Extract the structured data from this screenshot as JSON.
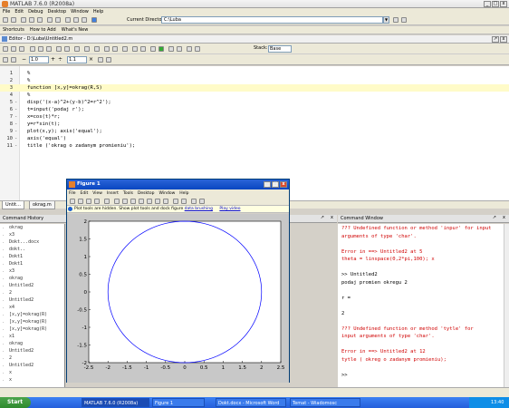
{
  "window": {
    "title": "MATLAB 7.6.0 (R2008a)"
  },
  "menu": [
    "File",
    "Edit",
    "Debug",
    "Desktop",
    "Window",
    "Help"
  ],
  "toolbar": {
    "current_directory_label": "Current Directory:",
    "current_directory_value": "C:\\Luba"
  },
  "shortcuts": [
    "Shortcuts",
    "How to Add",
    "What's New"
  ],
  "editor": {
    "title": "Editor - D:\\Luba\\Untitled2.m",
    "zoom_a": "1.0",
    "zoom_b": "1.1",
    "stack_label": "Stack:",
    "stack_value": "Base",
    "lines": [
      {
        "n": "1",
        "mark": "",
        "text": "%"
      },
      {
        "n": "2",
        "mark": "",
        "text": "%"
      },
      {
        "n": "3",
        "mark": "",
        "text": "function [x,y]=okrag(R,S)"
      },
      {
        "n": "4",
        "mark": "",
        "text": "%"
      },
      {
        "n": "5",
        "mark": "-",
        "text": "disp('(x-a)^2+(y-b)^2=r^2');"
      },
      {
        "n": "6",
        "mark": "-",
        "text": "t=input('podaj r');"
      },
      {
        "n": "7",
        "mark": "-",
        "text": "x=cos(t)*r;"
      },
      {
        "n": "8",
        "mark": "-",
        "text": "y=r*sin(t);"
      },
      {
        "n": "9",
        "mark": "-",
        "text": "plot(x,y); axis('equal');"
      },
      {
        "n": "10",
        "mark": "-",
        "text": "axis('equal')"
      },
      {
        "n": "11",
        "mark": "-",
        "text": "title ('okrag o zadanym promieniu');"
      }
    ],
    "tabs": [
      "Untit...",
      "okrag.m"
    ]
  },
  "history": {
    "title": "Command History",
    "rows": [
      "okrag",
      "x3",
      "Dokt...docx",
      "dokt..",
      "Dokt1",
      "Dokt1",
      "x3",
      "okrag",
      "Untitled2",
      "2",
      "Untitled2",
      "x4",
      "[x,y]=okrag(R)",
      "[x,y]=okrag(R)",
      "[x,y]=okrag(R)",
      "x1",
      "okrag",
      "Untitled2",
      "2",
      "Untitled2",
      "x",
      "x"
    ]
  },
  "command_window": {
    "title": "Command Window",
    "rows": [
      {
        "text": "??? Undefined function or method 'inpur' for input",
        "err": true
      },
      {
        "text": "arguments of type 'char'.",
        "err": true
      },
      {
        "text": "",
        "err": false
      },
      {
        "text": "Error in ==> Untitled2 at 5",
        "err": true
      },
      {
        "text": "theta = linspace(0,2*pi,100); x",
        "err": true
      },
      {
        "text": "",
        "err": false
      },
      {
        "text": ">> Untitled2",
        "err": false
      },
      {
        "text": "podaj promien okregu 2",
        "err": false
      },
      {
        "text": "",
        "err": false
      },
      {
        "text": "r =",
        "err": false
      },
      {
        "text": "",
        "err": false
      },
      {
        "text": "     2",
        "err": false
      },
      {
        "text": "",
        "err": false
      },
      {
        "text": "??? Undefined function or method 'tytle' for",
        "err": true
      },
      {
        "text": "input arguments of type 'char'.",
        "err": true
      },
      {
        "text": "",
        "err": false
      },
      {
        "text": "Error in ==> Untitled2 at 12",
        "err": true
      },
      {
        "text": "tytle ( okreg o zadanym promieniu); ",
        "err": true
      },
      {
        "text": "",
        "err": false
      },
      {
        "text": ">>",
        "err": false
      }
    ]
  },
  "figure": {
    "title": "Figure 1",
    "menu": [
      "File",
      "Edit",
      "View",
      "Insert",
      "Tools",
      "Desktop",
      "Window",
      "Help"
    ],
    "info_text": "Plot tools are hidden. Show plot tools and dock figure",
    "info_link1": "data brushing",
    "info_link2": "Play video"
  },
  "chart_data": {
    "type": "line",
    "title": "",
    "xlabel": "",
    "ylabel": "",
    "xlim": [
      -2.5,
      2.5
    ],
    "ylim": [
      -2,
      2
    ],
    "xticks": [
      "-2.5",
      "-2",
      "-1.5",
      "-1",
      "-0.5",
      "0",
      "0.5",
      "1",
      "1.5",
      "2",
      "2.5"
    ],
    "yticks": [
      "-2",
      "-1.5",
      "-1",
      "-0.5",
      "0",
      "0.5",
      "1",
      "1.5",
      "2"
    ],
    "series": [
      {
        "shape": "circle",
        "radius": 2,
        "center": [
          0,
          0
        ],
        "color": "#0000ff"
      }
    ],
    "grid": false
  },
  "taskbar": {
    "start": "Start",
    "tasks": [
      "MATLAB 7.6.0 (R2008a)",
      "Figure 1",
      "Dokt.docx - Microsoft Word",
      "Temat - Wiadomosc"
    ],
    "clock": "13:40"
  }
}
